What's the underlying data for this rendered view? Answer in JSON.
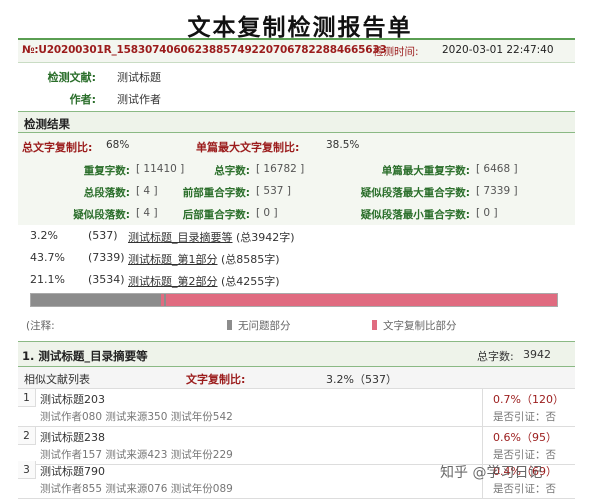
{
  "title": "文本复制检测报告单",
  "header": {
    "report_no": "№:U20200301R_1583074060623885749220706782288466563​3",
    "time_label": "检测时间:",
    "time_value": "2020-03-01 22:47:40",
    "doc_label": "检测文献:",
    "doc_value": "测试标题",
    "author_label": "作者:",
    "author_value": "测试作者"
  },
  "results": {
    "heading": "检测结果",
    "total_copy_label": "总文字复制比:",
    "total_copy_value": "68%",
    "max_single_label": "单篇最大文字复制比:",
    "max_single_value": "38.5%",
    "stats": [
      {
        "label": "重复字数:",
        "value": "[ 11410 ]"
      },
      {
        "label": "总字数:",
        "value": "[ 16782 ]"
      },
      {
        "label": "单篇最大重复字数:",
        "value": "[ 6468 ]"
      },
      {
        "label": "总段落数:",
        "value": "[ 4 ]"
      },
      {
        "label": "前部重合字数:",
        "value": "[ 537 ]"
      },
      {
        "label": "疑似段落最大重合字数:",
        "value": "[ 7339 ]"
      },
      {
        "label": "疑似段落数:",
        "value": "[ 4 ]"
      },
      {
        "label": "后部重合字数:",
        "value": "[ 0 ]"
      },
      {
        "label": "疑似段落最小重合字数:",
        "value": "[ 0 ]"
      }
    ]
  },
  "parts": [
    {
      "pct": "3.2%",
      "count": "(537)",
      "name": "测试标题_目录摘要等",
      "total": " (总3942字)"
    },
    {
      "pct": "43.7%",
      "count": "(7339)",
      "name": "测试标题_第1部分",
      "total": " (总8585字)"
    },
    {
      "pct": "21.1%",
      "count": "(3534)",
      "name": "测试标题_第2部分",
      "total": " (总4255字)"
    }
  ],
  "distribution_bar": {
    "no_problem_color": "#8c8c8c",
    "copied_color": "#e06b80"
  },
  "legend": {
    "note": "(注释:",
    "no_problem": "无问题部分",
    "copied": "文字复制比部分"
  },
  "detail": {
    "section_title": "1. 测试标题_目录摘要等",
    "total_label": "总字数:",
    "total_value": "3942",
    "list_label": "相似文献列表",
    "copy_label": "文字复制比:",
    "copy_value": "3.2%（537）",
    "items": [
      {
        "num": "1",
        "title": "测试标题203",
        "meta": "测试作者080 测试来源350 测试年份542",
        "ratio": "0.7%（120）",
        "cite": "是否引证：否"
      },
      {
        "num": "2",
        "title": "测试标题238",
        "meta": "测试作者157 测试来源423 测试年份229",
        "ratio": "0.6%（95）",
        "cite": "是否引证：否"
      },
      {
        "num": "3",
        "title": "测试标题790",
        "meta": "测试作者855 测试来源076 测试年份089",
        "ratio": "0.4%（69）",
        "cite": "是否引证：否"
      }
    ]
  },
  "watermark": "知乎 @学习日记"
}
